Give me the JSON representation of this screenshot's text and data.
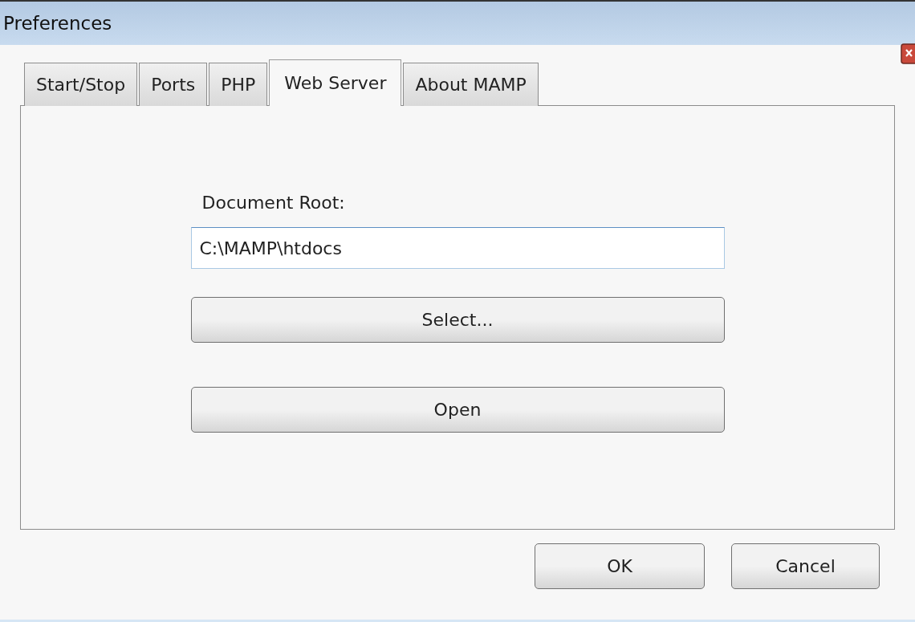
{
  "window": {
    "title": "Preferences"
  },
  "tabs": [
    {
      "label": "Start/Stop",
      "selected": false
    },
    {
      "label": "Ports",
      "selected": false
    },
    {
      "label": "PHP",
      "selected": false
    },
    {
      "label": "Web Server",
      "selected": true
    },
    {
      "label": "About MAMP",
      "selected": false
    }
  ],
  "document_root": {
    "label": "Document Root:",
    "value": "C:\\MAMP\\htdocs"
  },
  "panel_buttons": [
    "Select...",
    "Open"
  ],
  "dialog_buttons": [
    "OK",
    "Cancel"
  ]
}
